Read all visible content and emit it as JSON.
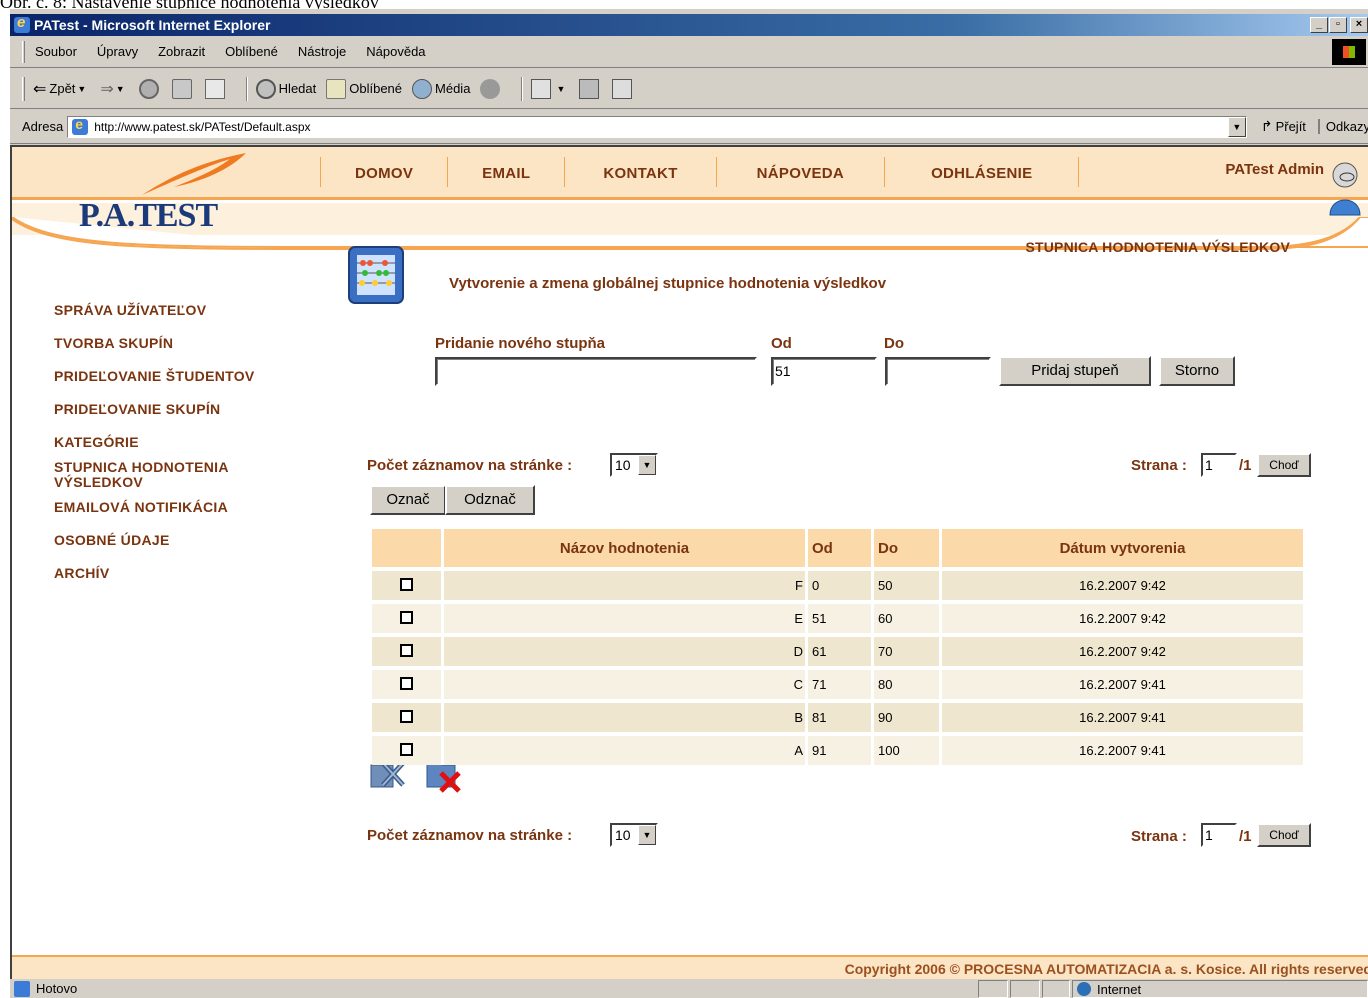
{
  "caption": "Obr. č. 8: Nastavenie stupnice hodnotenia výsledkov",
  "window": {
    "title": "PATest - Microsoft Internet Explorer"
  },
  "menu": [
    "Soubor",
    "Úpravy",
    "Zobrazit",
    "Oblíbené",
    "Nástroje",
    "Nápověda"
  ],
  "toolbar": {
    "back": "Zpět",
    "search": "Hledat",
    "favorites": "Oblíbené",
    "media": "Média"
  },
  "address": {
    "label": "Adresa",
    "url": "http://www.patest.sk/PATest/Default.aspx",
    "go": "Přejít",
    "links": "Odkazy"
  },
  "site": {
    "logo": "P.A.TEST",
    "nav": [
      "DOMOV",
      "EMAIL",
      "KONTAKT",
      "NÁPOVEDA",
      "ODHLÁSENIE"
    ],
    "user": "PATest Admin",
    "section_title": "STUPNICA HODNOTENIA VÝSLEDKOV",
    "sidebar": [
      "SPRÁVA UŽÍVATEĽOV",
      "TVORBA SKUPÍN",
      "PRIDEĽOVANIE ŠTUDENTOV",
      "PRIDEĽOVANIE SKUPÍN",
      "KATEGÓRIE",
      "STUPNICA HODNOTENIA VÝSLEDKOV",
      "EMAILOVÁ NOTIFIKÁCIA",
      "OSOBNÉ ÚDAJE",
      "ARCHÍV"
    ],
    "footer": "Copyright 2006 © PROCESNA AUTOMATIZACIA a. s. Kosice. All rights reserved"
  },
  "form": {
    "heading": "Vytvorenie a zmena globálnej stupnice hodnotenia výsledkov",
    "name_label": "Pridanie nového stupňa",
    "from_label": "Od",
    "to_label": "Do",
    "name_value": "",
    "from_value": "51",
    "to_value": "",
    "add_button": "Pridaj stupeň",
    "cancel_button": "Storno"
  },
  "pager": {
    "per_page_label": "Počet záznamov na stránke :",
    "per_page": "10",
    "page_label": "Strana :",
    "page": "1",
    "total": "/1",
    "go_button": "Choď"
  },
  "selection": {
    "mark": "Označ",
    "unmark": "Odznač"
  },
  "table": {
    "headers": [
      "Názov hodnotenia",
      "Od",
      "Do",
      "Dátum vytvorenia"
    ],
    "rows": [
      {
        "name": "F",
        "from": "0",
        "to": "50",
        "date": "16.2.2007 9:42"
      },
      {
        "name": "E",
        "from": "51",
        "to": "60",
        "date": "16.2.2007 9:42"
      },
      {
        "name": "D",
        "from": "61",
        "to": "70",
        "date": "16.2.2007 9:42"
      },
      {
        "name": "C",
        "from": "71",
        "to": "80",
        "date": "16.2.2007 9:41"
      },
      {
        "name": "B",
        "from": "81",
        "to": "90",
        "date": "16.2.2007 9:41"
      },
      {
        "name": "A",
        "from": "91",
        "to": "100",
        "date": "16.2.2007 9:41"
      }
    ]
  },
  "status": {
    "text": "Hotovo",
    "zone": "Internet"
  }
}
